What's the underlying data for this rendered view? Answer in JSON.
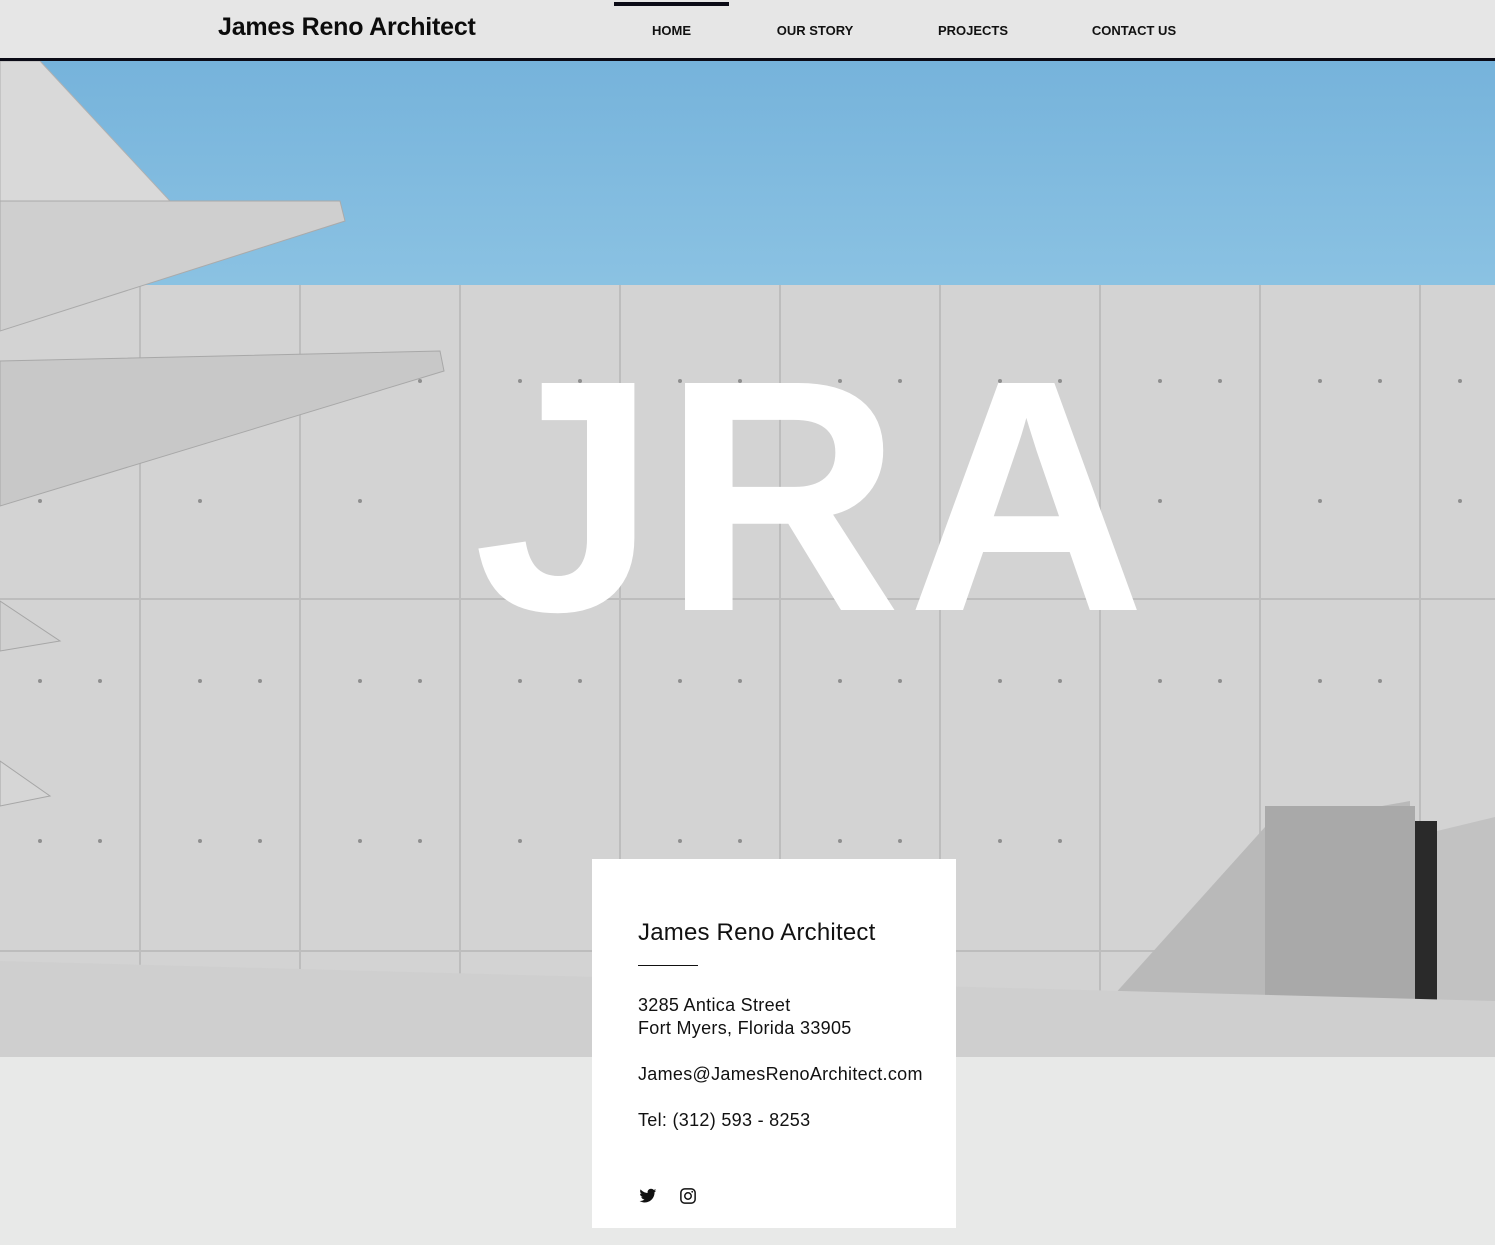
{
  "header": {
    "brand": "James Reno Architect",
    "nav": [
      {
        "label": "HOME",
        "active": true
      },
      {
        "label": "OUR STORY",
        "active": false
      },
      {
        "label": "PROJECTS",
        "active": false
      },
      {
        "label": "CONTACT US",
        "active": false
      }
    ]
  },
  "hero": {
    "monogram": "JRA"
  },
  "contact_card": {
    "title": "James Reno Architect",
    "address_line1": "3285 Antica Street",
    "address_line2": "Fort Myers, Florida 33905",
    "email": "James@JamesRenoArchitect.com",
    "phone": "Tel: (312) 593 - 8253",
    "social": [
      {
        "icon": "twitter-icon"
      },
      {
        "icon": "instagram-icon"
      }
    ]
  },
  "colors": {
    "sky": "#7fb8dc",
    "concrete": "#d2d2d2",
    "footer_bg": "#e8e9e8",
    "accent": "#0b0b16"
  }
}
